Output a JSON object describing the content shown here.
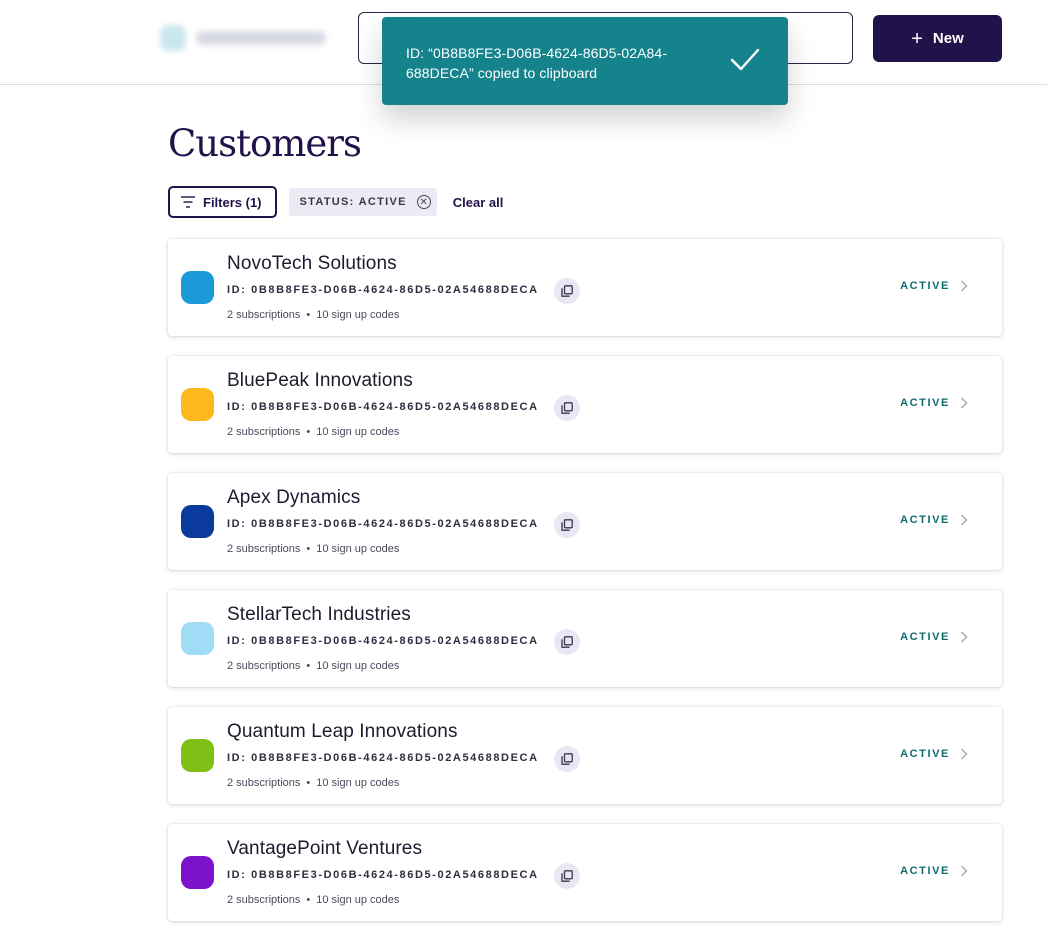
{
  "header": {
    "new_button_label": "New",
    "new_button_icon": "plus-icon",
    "search_value": ""
  },
  "toast": {
    "message": "ID: “0B8B8FE3-D06B-4624-86D5-02A84-688DECA” copied to clipboard",
    "icon": "check-icon",
    "color": "#15838c"
  },
  "page": {
    "title": "Customers"
  },
  "filters": {
    "button_label": "Filters (1)",
    "chip_label": "STATUS: ACTIVE",
    "clear_label": "Clear all"
  },
  "customers": [
    {
      "name": "NovoTech Solutions",
      "id": "ID: 0B8B8FE3-D06B-4624-86D5-02A54688DECA",
      "subscriptions": "2 subscriptions",
      "codes": "10 sign up codes",
      "status": "ACTIVE",
      "color": "#1a9bd7"
    },
    {
      "name": "BluePeak Innovations",
      "id": "ID: 0B8B8FE3-D06B-4624-86D5-02A54688DECA",
      "subscriptions": "2 subscriptions",
      "codes": "10 sign up codes",
      "status": "ACTIVE",
      "color": "#fbb91f"
    },
    {
      "name": "Apex Dynamics",
      "id": "ID: 0B8B8FE3-D06B-4624-86D5-02A54688DECA",
      "subscriptions": "2 subscriptions",
      "codes": "10 sign up codes",
      "status": "ACTIVE",
      "color": "#0a3a9b"
    },
    {
      "name": "StellarTech Industries",
      "id": "ID: 0B8B8FE3-D06B-4624-86D5-02A54688DECA",
      "subscriptions": "2 subscriptions",
      "codes": "10 sign up codes",
      "status": "ACTIVE",
      "color": "#a1dcf6"
    },
    {
      "name": "Quantum Leap Innovations",
      "id": "ID: 0B8B8FE3-D06B-4624-86D5-02A54688DECA",
      "subscriptions": "2 subscriptions",
      "codes": "10 sign up codes",
      "status": "ACTIVE",
      "color": "#7fbf16"
    },
    {
      "name": "VantagePoint Ventures",
      "id": "ID: 0B8B8FE3-D06B-4624-86D5-02A54688DECA",
      "subscriptions": "2 subscriptions",
      "codes": "10 sign up codes",
      "status": "ACTIVE",
      "color": "#7c12c9"
    }
  ],
  "colors": {
    "brand_dark": "#21124a",
    "status_active": "#0f6b6e",
    "copy_button_bg": "#e9e7f3"
  }
}
